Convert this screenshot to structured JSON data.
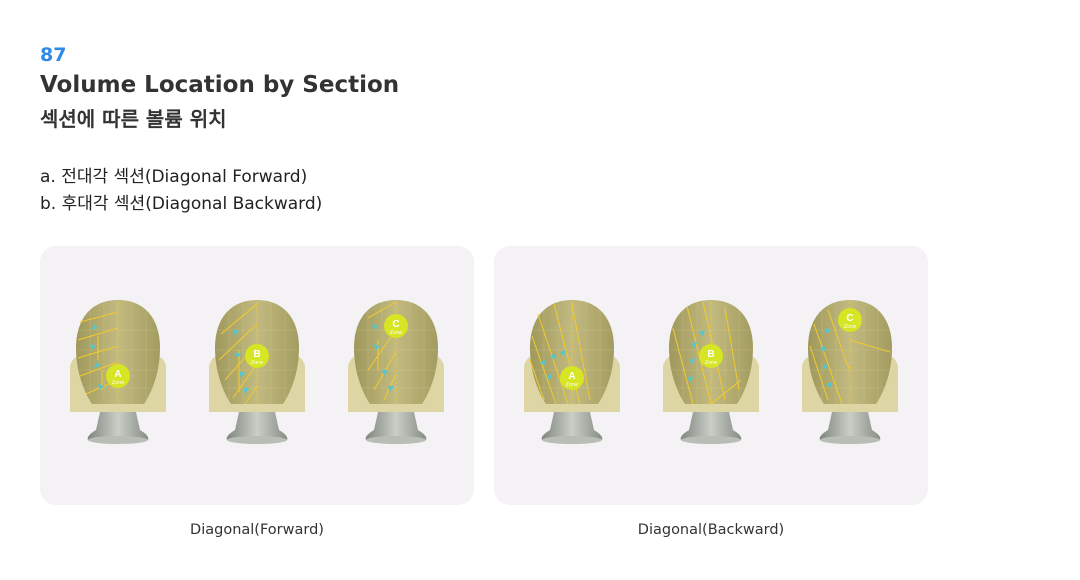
{
  "header": {
    "number": "87",
    "title_en": "Volume Location by Section",
    "title_ko": "섹션에 따른 볼륨 위치"
  },
  "items": [
    "a. 전대각 섹션(Diagonal Forward)",
    "b. 후대각 섹션(Diagonal Backward)"
  ],
  "panels": [
    {
      "caption": "Diagonal(Forward)",
      "heads": [
        {
          "zone_letter": "A",
          "zone_word": "Zone"
        },
        {
          "zone_letter": "B",
          "zone_word": "Zone"
        },
        {
          "zone_letter": "C",
          "zone_word": "Zone"
        }
      ]
    },
    {
      "caption": "Diagonal(Backward)",
      "heads": [
        {
          "zone_letter": "A",
          "zone_word": "Zone"
        },
        {
          "zone_letter": "B",
          "zone_word": "Zone"
        },
        {
          "zone_letter": "C",
          "zone_word": "Zone"
        }
      ]
    }
  ],
  "colors": {
    "accent_number": "#2f8be6",
    "hair": "#b5ae72",
    "hair_light": "#ddd6a4",
    "section_line": "#f2cb2c",
    "zone_badge": "#d6e524",
    "arrow": "#52c7cf",
    "neck": "#9aa19a",
    "panel_bg": "#f4f2f4"
  }
}
